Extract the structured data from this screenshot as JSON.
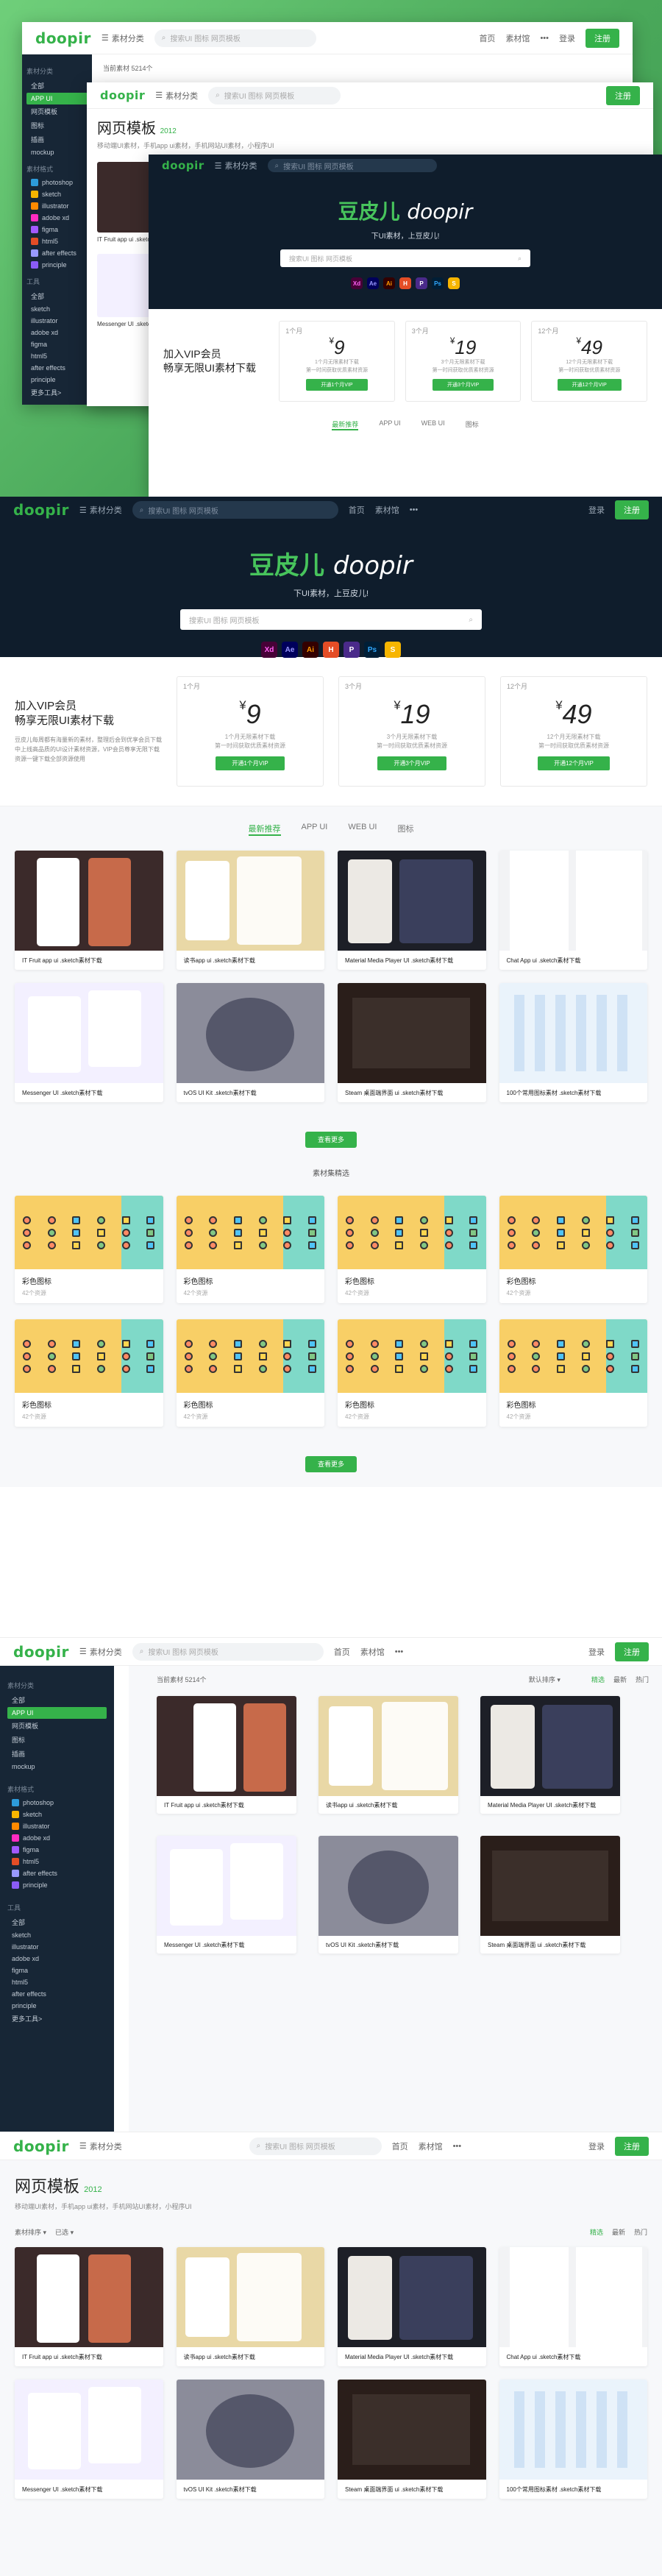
{
  "brand": {
    "logo": "doopir",
    "hero_cn": "豆皮儿",
    "hero_en": "doopir",
    "slogan": "下UI素材，上豆皮儿!"
  },
  "nav": {
    "material_category": "素材分类",
    "search_placeholder": "搜索UI 图标 网页模板",
    "more": "•••",
    "nav1": "首页",
    "nav2": "素材馆",
    "login": "登录",
    "register": "注册"
  },
  "apps": [
    "Xd",
    "Ae",
    "Ai",
    "H",
    "P",
    "Ps",
    "S"
  ],
  "vip": {
    "title1": "加入VIP会员",
    "title2": "畅享无限UI素材下载",
    "desc": "豆皮儿每周都有海量新的素材，整理后会到优享会员下载中上线高品质的UI设计素材资源，VIP会员尊享无限下载资源一键下载全部资源使用",
    "plans": [
      {
        "duration": "1个月",
        "price": "9",
        "line1": "1个月无限素材下载",
        "line2": "第一时间获取优质素材资源",
        "button": "开通1个月VIP"
      },
      {
        "duration": "3个月",
        "price": "19",
        "line1": "3个月无限素材下载",
        "line2": "第一时间获取优质素材资源",
        "button": "开通3个月VIP"
      },
      {
        "duration": "12个月",
        "price": "49",
        "line1": "12个月无限素材下载",
        "line2": "第一时间获取优质素材资源",
        "button": "开通12个月VIP"
      }
    ]
  },
  "tabs": [
    "最新推荐",
    "APP UI",
    "WEB UI",
    "图标"
  ],
  "cards": [
    {
      "title": "IT Fruit app ui .sketch素材下载",
      "bg": "#3b2a2a"
    },
    {
      "title": "读书app ui .sketch素材下载",
      "bg": "#e9d8a6"
    },
    {
      "title": "Material Media Player UI .sketch素材下载",
      "bg": "#1d1f27"
    },
    {
      "title": "Chat App ui .sketch素材下载",
      "bg": "#f2f3f5"
    },
    {
      "title": "Messenger UI .sketch素材下载",
      "bg": "#f3f0ff"
    },
    {
      "title": "tvOS UI Kit .sketch素材下载",
      "bg": "#8b8c9a"
    },
    {
      "title": "Steam 桌面端界面 ui .sketch素材下载",
      "bg": "#2a1e1a"
    },
    {
      "title": "100个常用图标素材 .sketch素材下载",
      "bg": "#eaf3fb"
    }
  ],
  "load_more": "查看更多",
  "recommend_title": "素材集精选",
  "icon_sets": [
    {
      "title": "彩色图标",
      "sub": "42个资源"
    },
    {
      "title": "彩色图标",
      "sub": "42个资源"
    },
    {
      "title": "彩色图标",
      "sub": "42个资源"
    },
    {
      "title": "彩色图标",
      "sub": "42个资源"
    },
    {
      "title": "彩色图标",
      "sub": "42个资源"
    },
    {
      "title": "彩色图标",
      "sub": "42个资源"
    },
    {
      "title": "彩色图标",
      "sub": "42个资源"
    },
    {
      "title": "彩色图标",
      "sub": "42个资源"
    }
  ],
  "sidebar": {
    "head1": "素材分类",
    "items1": [
      "全部",
      "APP UI",
      "网页模板",
      "图标",
      "插画",
      "mockup"
    ],
    "head2": "素材格式",
    "items2": [
      "photoshop",
      "sketch",
      "illustrator",
      "adobe xd",
      "figma",
      "html5",
      "after effects",
      "principle"
    ],
    "head3": "工具",
    "items3": [
      "全部",
      "sketch",
      "illustrator",
      "adobe xd",
      "figma",
      "html5",
      "after effects",
      "principle",
      "更多工具>"
    ]
  },
  "list": {
    "count": "当前素材 5214个",
    "sort_label": "默认排序",
    "filter_new": "精选",
    "filter_free": "最新",
    "filter_hot": "热门"
  },
  "webpage": {
    "title": "网页模板",
    "count": "2012",
    "desc": "移动端UI素材，手机app ui素材，手机网站UI素材，小程序UI",
    "filter1": "素材排序",
    "filter2": "已选"
  },
  "colors": {
    "accent": "#35b24a",
    "dark": "#0f1d2c"
  }
}
